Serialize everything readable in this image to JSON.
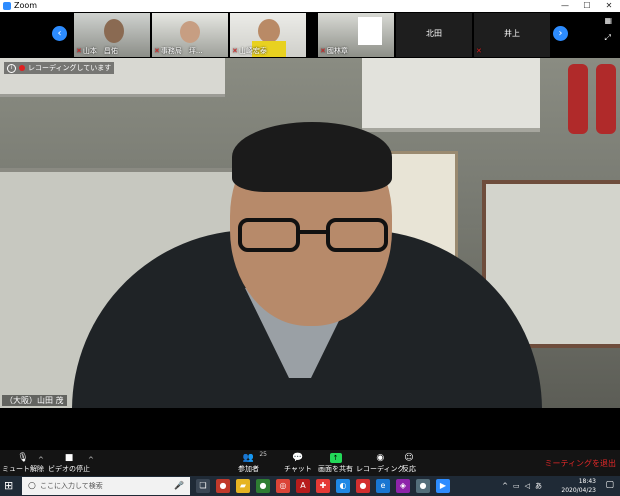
{
  "window": {
    "title": "Zoom",
    "minimize": "—",
    "maximize": "☐",
    "close": "✕"
  },
  "participants": [
    {
      "name": "山本　昌佑"
    },
    {
      "name": "事務局　坪..."
    },
    {
      "name": "山崎宏泰"
    },
    {
      "name": "國林章"
    },
    {
      "name": "北田"
    },
    {
      "name": "井上"
    }
  ],
  "recording": {
    "label": "レコーディングしています"
  },
  "main_video": {
    "speaker": "（大阪）山田 茂"
  },
  "toolbar": {
    "mute": "ミュート解除",
    "video": "ビデオの停止",
    "participants": "参加者",
    "participants_count": "25",
    "chat": "チャット",
    "share": "画面を共有",
    "record": "レコーディング",
    "reactions": "反応",
    "leave": "ミーティングを退出"
  },
  "taskbar": {
    "search_placeholder": "ここに入力して検索",
    "ime": "あ",
    "time": "18:43",
    "date": "2020/04/23"
  },
  "colors": {
    "accent": "#2d8cff",
    "leave": "#e02828",
    "share": "#23d959"
  }
}
